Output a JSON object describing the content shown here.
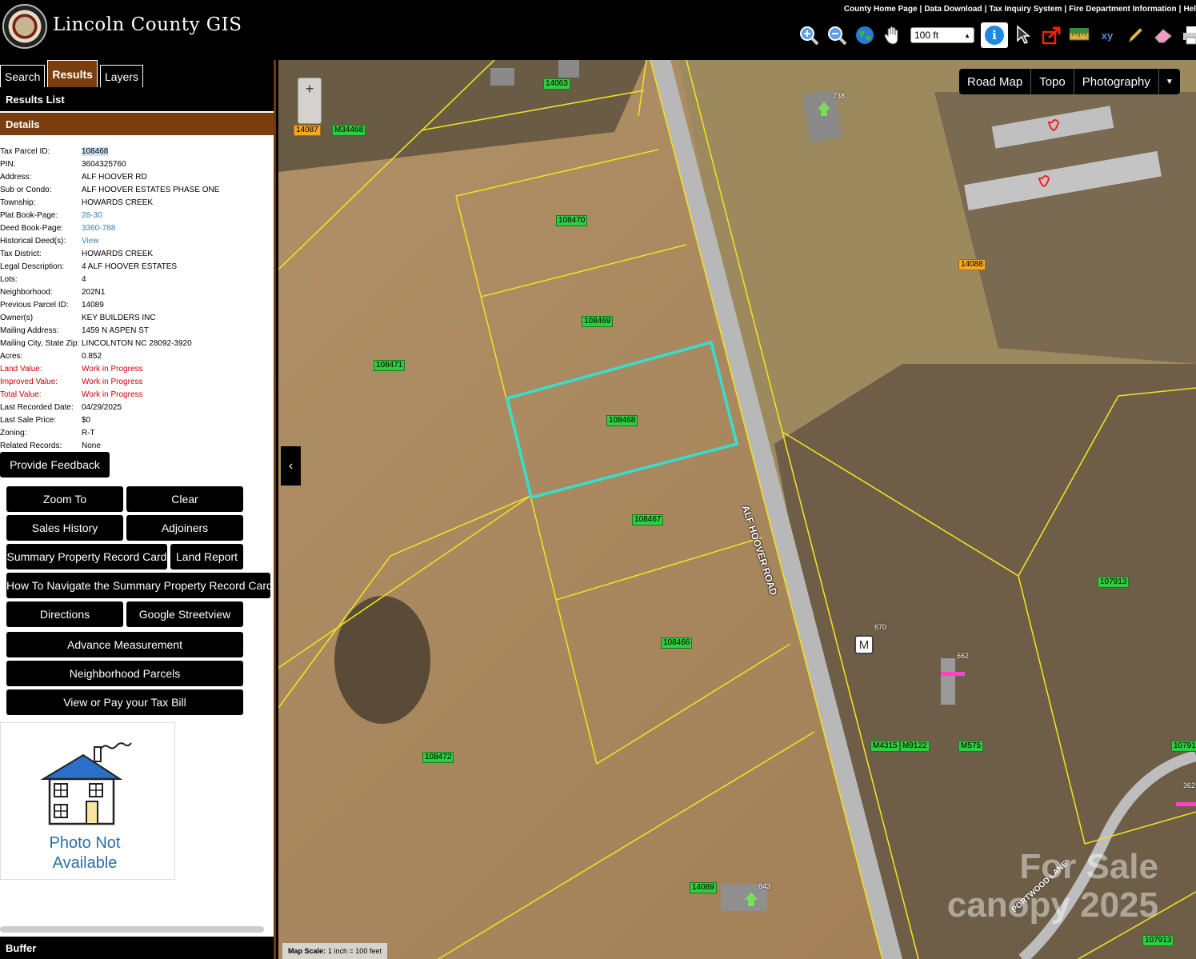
{
  "header": {
    "title": "Lincoln County GIS",
    "top_links": [
      "County Home Page",
      "Data Download",
      "Tax Inquiry System",
      "Fire Department Information",
      "Hel"
    ],
    "scale_value": "100 ft"
  },
  "tabs": [
    "Search",
    "Results",
    "Layers"
  ],
  "results_list_label": "Results List",
  "details_label": "Details",
  "details": [
    {
      "label": "Tax Parcel ID:",
      "value": "108468"
    },
    {
      "label": "PIN:",
      "value": "3604325760"
    },
    {
      "label": "Address:",
      "value": "ALF HOOVER RD"
    },
    {
      "label": "Sub or Condo:",
      "value": "ALF HOOVER ESTATES PHASE ONE"
    },
    {
      "label": "Township:",
      "value": "HOWARDS CREEK"
    },
    {
      "label": "Plat Book-Page:",
      "value": "28-30"
    },
    {
      "label": "Deed Book-Page:",
      "value": "3360-788"
    },
    {
      "label": "Historical Deed(s):",
      "value": "View"
    },
    {
      "label": "Tax District:",
      "value": "HOWARDS CREEK"
    },
    {
      "label": "Legal Description:",
      "value": "4 ALF HOOVER ESTATES"
    },
    {
      "label": "Lots:",
      "value": "4"
    },
    {
      "label": "Neighborhood:",
      "value": "202N1"
    },
    {
      "label": "Previous Parcel ID:",
      "value": "14089"
    },
    {
      "label": "Owner(s)",
      "value": "KEY BUILDERS INC"
    },
    {
      "label": "Mailing Address:",
      "value": "1459 N ASPEN ST"
    },
    {
      "label": "Mailing City, State Zip:",
      "value": "LINCOLNTON NC 28092-3920"
    },
    {
      "label": "Acres:",
      "value": "0.852"
    },
    {
      "label": "Land Value:",
      "value": "Work in Progress"
    },
    {
      "label": "Improved Value:",
      "value": "Work in Progress"
    },
    {
      "label": "Total Value:",
      "value": "Work in Progress"
    },
    {
      "label": "Last Recorded Date:",
      "value": "04/29/2025"
    },
    {
      "label": "Last Sale Price:",
      "value": "$0"
    },
    {
      "label": "Zoning:",
      "value": "R-T"
    },
    {
      "label": "Related Records:",
      "value": "None"
    }
  ],
  "buttons": {
    "feedback": "Provide Feedback",
    "zoom_to": "Zoom To",
    "clear": "Clear",
    "sales_history": "Sales History",
    "adjoiners": "Adjoiners",
    "summary_card": "Summary Property Record Card",
    "land_report": "Land Report",
    "how_to": "How To Navigate the Summary Property Record Card",
    "directions": "Directions",
    "streetview": "Google Streetview",
    "advance_measurement": "Advance Measurement",
    "neighborhood_parcels": "Neighborhood Parcels",
    "tax_bill": "View or Pay your Tax Bill"
  },
  "photo_text": [
    "Photo Not",
    "Available"
  ],
  "buffer_label": "Buffer",
  "map": {
    "basemaps": [
      "Road Map",
      "Topo",
      "Photography"
    ],
    "scale_label": "Map Scale:",
    "scale_value": "1 inch = 100 feet",
    "road_name": "ALF HOOVER ROAD",
    "lane_name": "PORTWOOD LANE",
    "watermark": [
      "For Sale",
      "canopy 2025"
    ],
    "marker_letter": "M",
    "parcel_labels": [
      "14063",
      "14087",
      "M34468",
      "108470",
      "108469",
      "108471",
      "108468",
      "108467",
      "108466",
      "108472",
      "14089",
      "14088",
      "107913",
      "M4315",
      "M9122",
      "M575",
      "10791",
      "107913"
    ],
    "address_labels": [
      "738",
      "670",
      "662",
      "843",
      "362"
    ]
  },
  "colors": {
    "accent_brown": "#7a3e0e",
    "selected_parcel": "#33e0d0",
    "parcel_line": "#f0e020",
    "parcel_label": "#2ecc40",
    "parcel_label_alt": "#f5a623",
    "red_text": "#cc0000",
    "link": "#3a7fb8"
  }
}
